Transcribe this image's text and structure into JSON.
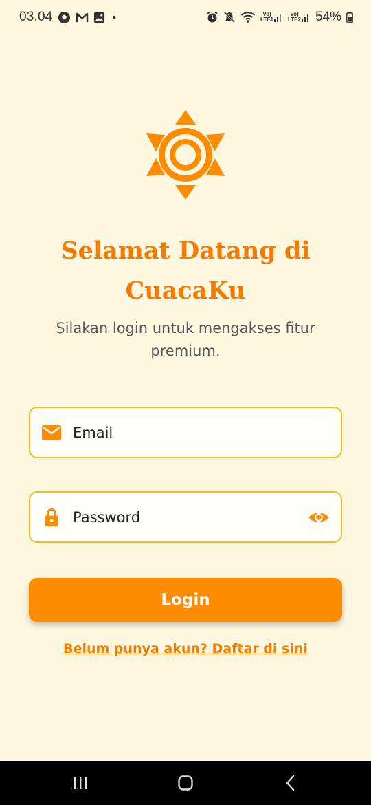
{
  "status_bar": {
    "time": "03.04",
    "dot": "•",
    "lte1": [
      "Vo)",
      "LTE1"
    ],
    "lte2": [
      "Vo)",
      "LTE2"
    ],
    "battery": "54%",
    "icons": [
      "soccer-ball-icon",
      "gmail-icon",
      "gallery-icon",
      "alarm-icon",
      "mute-icon",
      "wifi-icon",
      "signal-icon",
      "battery-icon"
    ]
  },
  "app": {
    "title": "Selamat Datang di CuacaKu",
    "subtitle": "Silakan login untuk mengakses fitur premium.",
    "accent_color": "#F57C00",
    "field_border_color": "#F4BC1C",
    "background_color": "#FFF8E1"
  },
  "form": {
    "email_placeholder": "Email",
    "email_icon": "mail-icon",
    "password_placeholder": "Password",
    "password_icon": "lock-icon",
    "toggle_icon": "eye-icon",
    "login_label": "Login",
    "register_link": "Belum punya akun? Daftar di sini"
  },
  "nav": {
    "icons": [
      "recent-apps-icon",
      "home-icon",
      "back-icon"
    ]
  }
}
